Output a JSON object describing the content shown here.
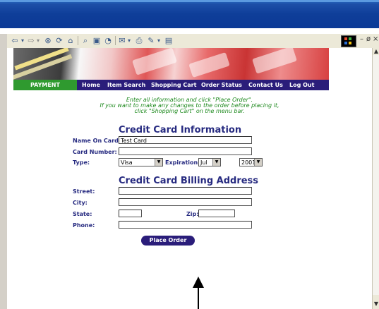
{
  "toolbar": {
    "back_icon": "back-arrow-icon",
    "forward_icon": "forward-arrow-icon",
    "win_min": "–",
    "win_restore": "ø",
    "win_close": "×"
  },
  "nav": {
    "payment": "PAYMENT",
    "items": [
      "Home",
      "Item Search",
      "Shopping Cart",
      "Order Status",
      "Contact Us",
      "Log Out"
    ]
  },
  "instructions": {
    "line1": "Enter all information and click \"Place Order\".",
    "line2": "If you want to make any changes to the order before placing it,",
    "line3": "click \"Shopping Cart\" on the menu bar."
  },
  "card_info": {
    "title": "Credit Card Information",
    "name_label": "Name On Card:",
    "name_value": "Test Card",
    "number_label": "Card Number:",
    "number_value": "",
    "type_label": "Type:",
    "type_value": "Visa",
    "expiration_label": "Expiration:",
    "exp_month": "Jul",
    "exp_year": "2001"
  },
  "billing": {
    "title": "Credit Card Billing Address",
    "street_label": "Street:",
    "city_label": "City:",
    "state_label": "State:",
    "zip_label": "Zip:",
    "phone_label": "Phone:"
  },
  "actions": {
    "place_order": "Place Order"
  }
}
